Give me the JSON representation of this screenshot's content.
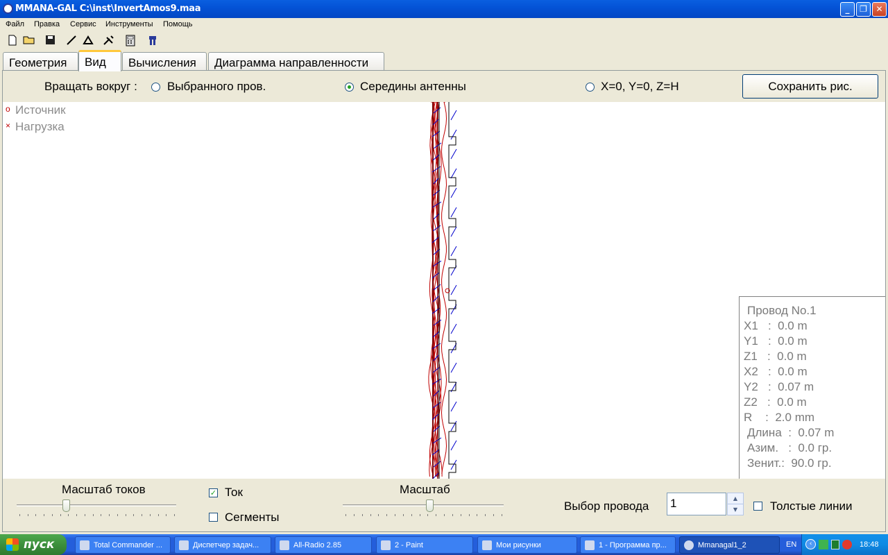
{
  "window": {
    "title": "MMANA-GAL C:\\inst\\InvertAmos9.maa"
  },
  "menu": [
    "Файл",
    "Правка",
    "Сервис",
    "Инструменты",
    "Помощь"
  ],
  "toolbar_icons": [
    "new-file-icon",
    "open-folder-icon",
    "save-disk-icon",
    "draw-line-icon",
    "triangle-icon",
    "tools-icon",
    "calculator-icon",
    "figure-icon"
  ],
  "tabs": [
    {
      "label": "Геометрия",
      "active": false
    },
    {
      "label": "Вид",
      "active": true
    },
    {
      "label": "Вычисления",
      "active": false
    },
    {
      "label": "Диаграмма направленности",
      "active": false
    }
  ],
  "rotate": {
    "label": "Вращать вокруг :",
    "options": [
      {
        "label": "Выбранного пров.",
        "selected": false
      },
      {
        "label": "Середины антенны",
        "selected": true
      },
      {
        "label": "X=0, Y=0, Z=H",
        "selected": false
      }
    ],
    "save_button": "Сохранить рис."
  },
  "legend": {
    "source": "Источник",
    "load": "Нагрузка"
  },
  "wire_info": {
    "title": "Провод No.1",
    "x1": "X1   :  0.0 m",
    "y1": "Y1   :  0.0 m",
    "z1": "Z1   :  0.0 m",
    "x2": "X2   :  0.0 m",
    "y2": "Y2   :  0.07 m",
    "z2": "Z2   :  0.0 m",
    "r": "R    :  2.0 mm",
    "length": "Длина  :  0.07 m",
    "azimuth": "Азим.   :  0.0 гр.",
    "zenith": "Зенит.:  90.0 гр."
  },
  "controls": {
    "current_scale_label": "Масштаб токов",
    "current_label": "Ток",
    "current_checked": true,
    "segments_label": "Сегменты",
    "segments_checked": false,
    "scale_label": "Масштаб",
    "wire_select_label": "Выбор провода",
    "wire_select_value": "1",
    "thick_lines_label": "Толстые линии",
    "thick_lines_checked": false
  },
  "taskbar": {
    "start": "пуск",
    "tasks": [
      {
        "label": "Total Commander ...",
        "active": false
      },
      {
        "label": "Диспетчер задач...",
        "active": false
      },
      {
        "label": "All-Radio 2.85",
        "active": false
      },
      {
        "label": "2 - Paint",
        "active": false
      },
      {
        "label": "Мои рисунки",
        "active": false
      },
      {
        "label": "1 - Программа пр...",
        "active": false
      },
      {
        "label": "Mmanagal1_2",
        "active": true
      }
    ],
    "lang": "EN",
    "clock": "18:48"
  },
  "colors": {
    "current_red": "#c00000",
    "current_blue": "#0000cc",
    "wire": "#000000"
  }
}
